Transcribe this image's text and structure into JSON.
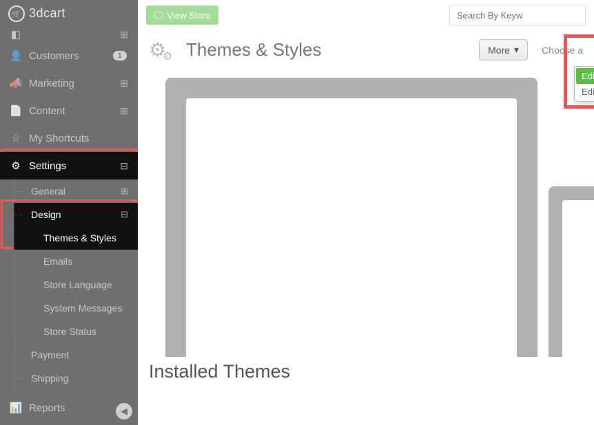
{
  "logo_text": "3dcart",
  "topbar": {
    "view_store": "View Store",
    "search_placeholder": "Search By Keyw"
  },
  "page_title": "Themes & Styles",
  "more_btn": "More",
  "choose_link": "Choose a",
  "dropdown": {
    "edit_html": "Edit Template (HTML)",
    "edit_css": "Edit Look/Colors (CSS)"
  },
  "sidebar": {
    "customers": "Customers",
    "customers_badge": "1",
    "marketing": "Marketing",
    "content": "Content",
    "shortcuts": "My Shortcuts",
    "settings": "Settings",
    "general": "General",
    "design": "Design",
    "themes": "Themes & Styles",
    "emails": "Emails",
    "store_lang": "Store Language",
    "sys_msg": "System Messages",
    "store_status": "Store Status",
    "payment": "Payment",
    "shipping": "Shipping",
    "reports": "Reports"
  },
  "section_title": "Installed Themes"
}
